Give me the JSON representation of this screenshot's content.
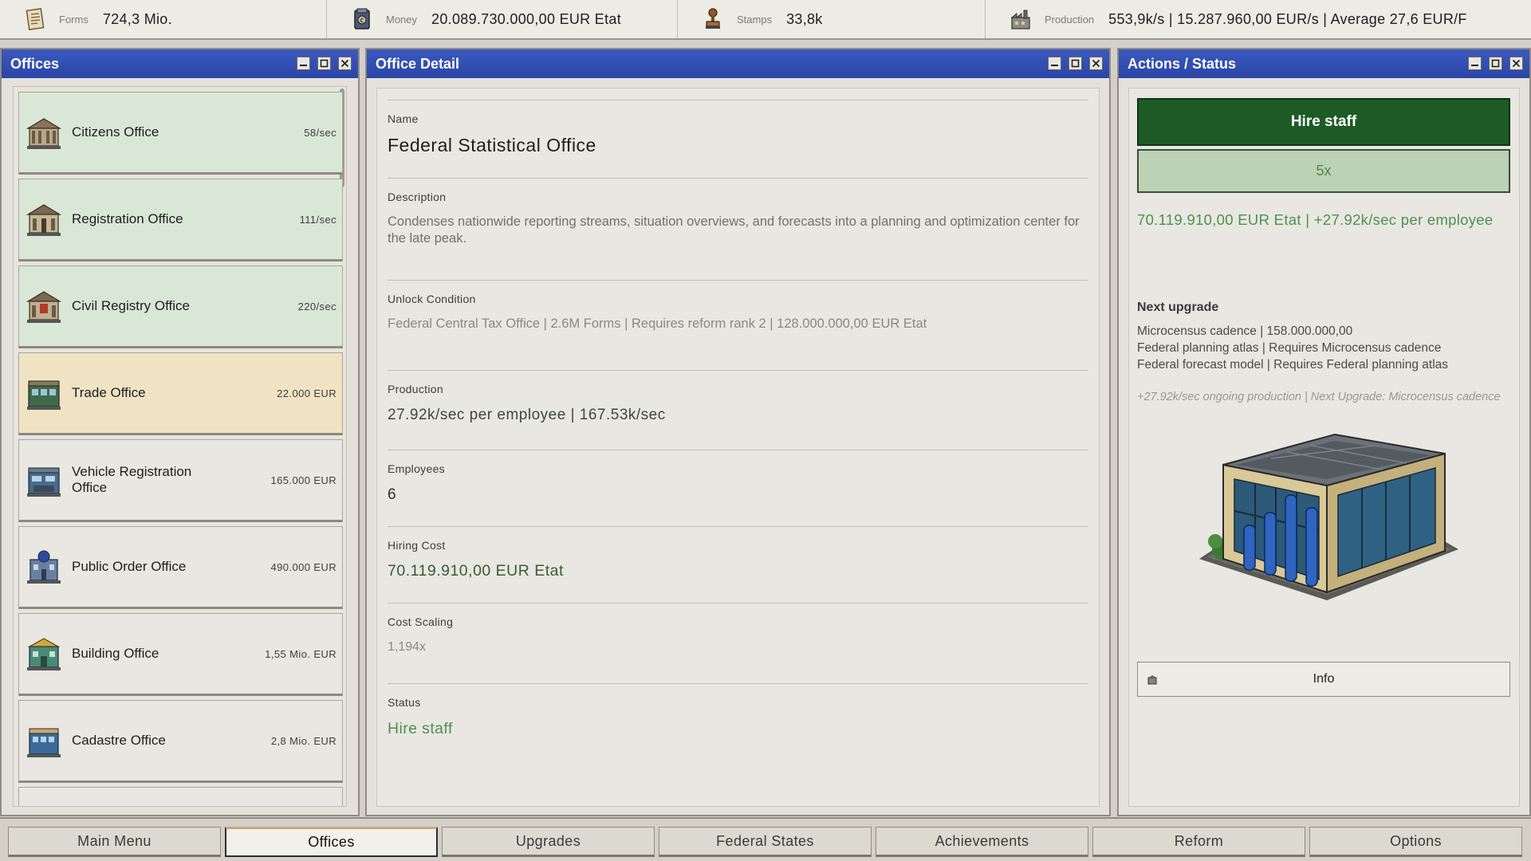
{
  "resources": [
    {
      "icon": "forms-icon",
      "label": "Forms",
      "value": "724,3 Mio."
    },
    {
      "icon": "money-icon",
      "label": "Money",
      "value": "20.089.730.000,00 EUR Etat"
    },
    {
      "icon": "stamp-icon",
      "label": "Stamps",
      "value": "33,8k"
    },
    {
      "icon": "factory-icon",
      "label": "Production",
      "value": "553,9k/s | 15.287.960,00 EUR/s | Average 27,6 EUR/F"
    }
  ],
  "offices_panel": {
    "title": "Offices",
    "items": [
      {
        "name": "Citizens Office",
        "rate": "58/sec",
        "state": "unlocked"
      },
      {
        "name": "Registration Office",
        "rate": "111/sec",
        "state": "unlocked"
      },
      {
        "name": "Civil Registry Office",
        "rate": "220/sec",
        "state": "unlocked"
      },
      {
        "name": "Trade Office",
        "rate": "22.000 EUR",
        "state": "selected"
      },
      {
        "name": "Vehicle Registration Office",
        "rate": "165.000 EUR",
        "state": "locked"
      },
      {
        "name": "Public Order Office",
        "rate": "490.000 EUR",
        "state": "locked"
      },
      {
        "name": "Building Office",
        "rate": "1,55 Mio. EUR",
        "state": "locked"
      },
      {
        "name": "Cadastre Office",
        "rate": "2,8 Mio. EUR",
        "state": "locked"
      }
    ]
  },
  "detail_panel": {
    "title": "Office Detail",
    "name_label": "Name",
    "name_value": "Federal Statistical Office",
    "description_label": "Description",
    "description_value": "Condenses nationwide reporting streams, situation overviews, and forecasts into a planning and optimization center for the late peak.",
    "unlock_label": "Unlock Condition",
    "unlock_value": "Federal Central Tax Office | 2.6M Forms | Requires reform rank 2 | 128.000.000,00 EUR Etat",
    "production_label": "Production",
    "production_value": "27.92k/sec per employee | 167.53k/sec",
    "employees_label": "Employees",
    "employees_value": "6",
    "hiring_label": "Hiring Cost",
    "hiring_value": "70.119.910,00 EUR Etat",
    "scaling_label": "Cost Scaling",
    "scaling_value": "1,194x",
    "status_label": "Status",
    "status_value": "Hire staff"
  },
  "actions_panel": {
    "title": "Actions / Status",
    "hire_button": "Hire staff",
    "multiplier_button": "5x",
    "cost_summary": "70.119.910,00 EUR Etat | +27.92k/sec per employee",
    "next_upgrade_label": "Next upgrade",
    "upgrades": [
      "Microcensus cadence | 158.000.000,00",
      "Federal planning atlas | Requires Microcensus cadence",
      "Federal forecast model | Requires Federal planning atlas"
    ],
    "hint": "+27.92k/sec ongoing production | Next Upgrade: Microcensus cadence",
    "info_button": "Info"
  },
  "nav": [
    {
      "label": "Main Menu",
      "active": false
    },
    {
      "label": "Offices",
      "active": true
    },
    {
      "label": "Upgrades",
      "active": false
    },
    {
      "label": "Federal States",
      "active": false
    },
    {
      "label": "Achievements",
      "active": false
    },
    {
      "label": "Reform",
      "active": false
    },
    {
      "label": "Options",
      "active": false
    }
  ]
}
